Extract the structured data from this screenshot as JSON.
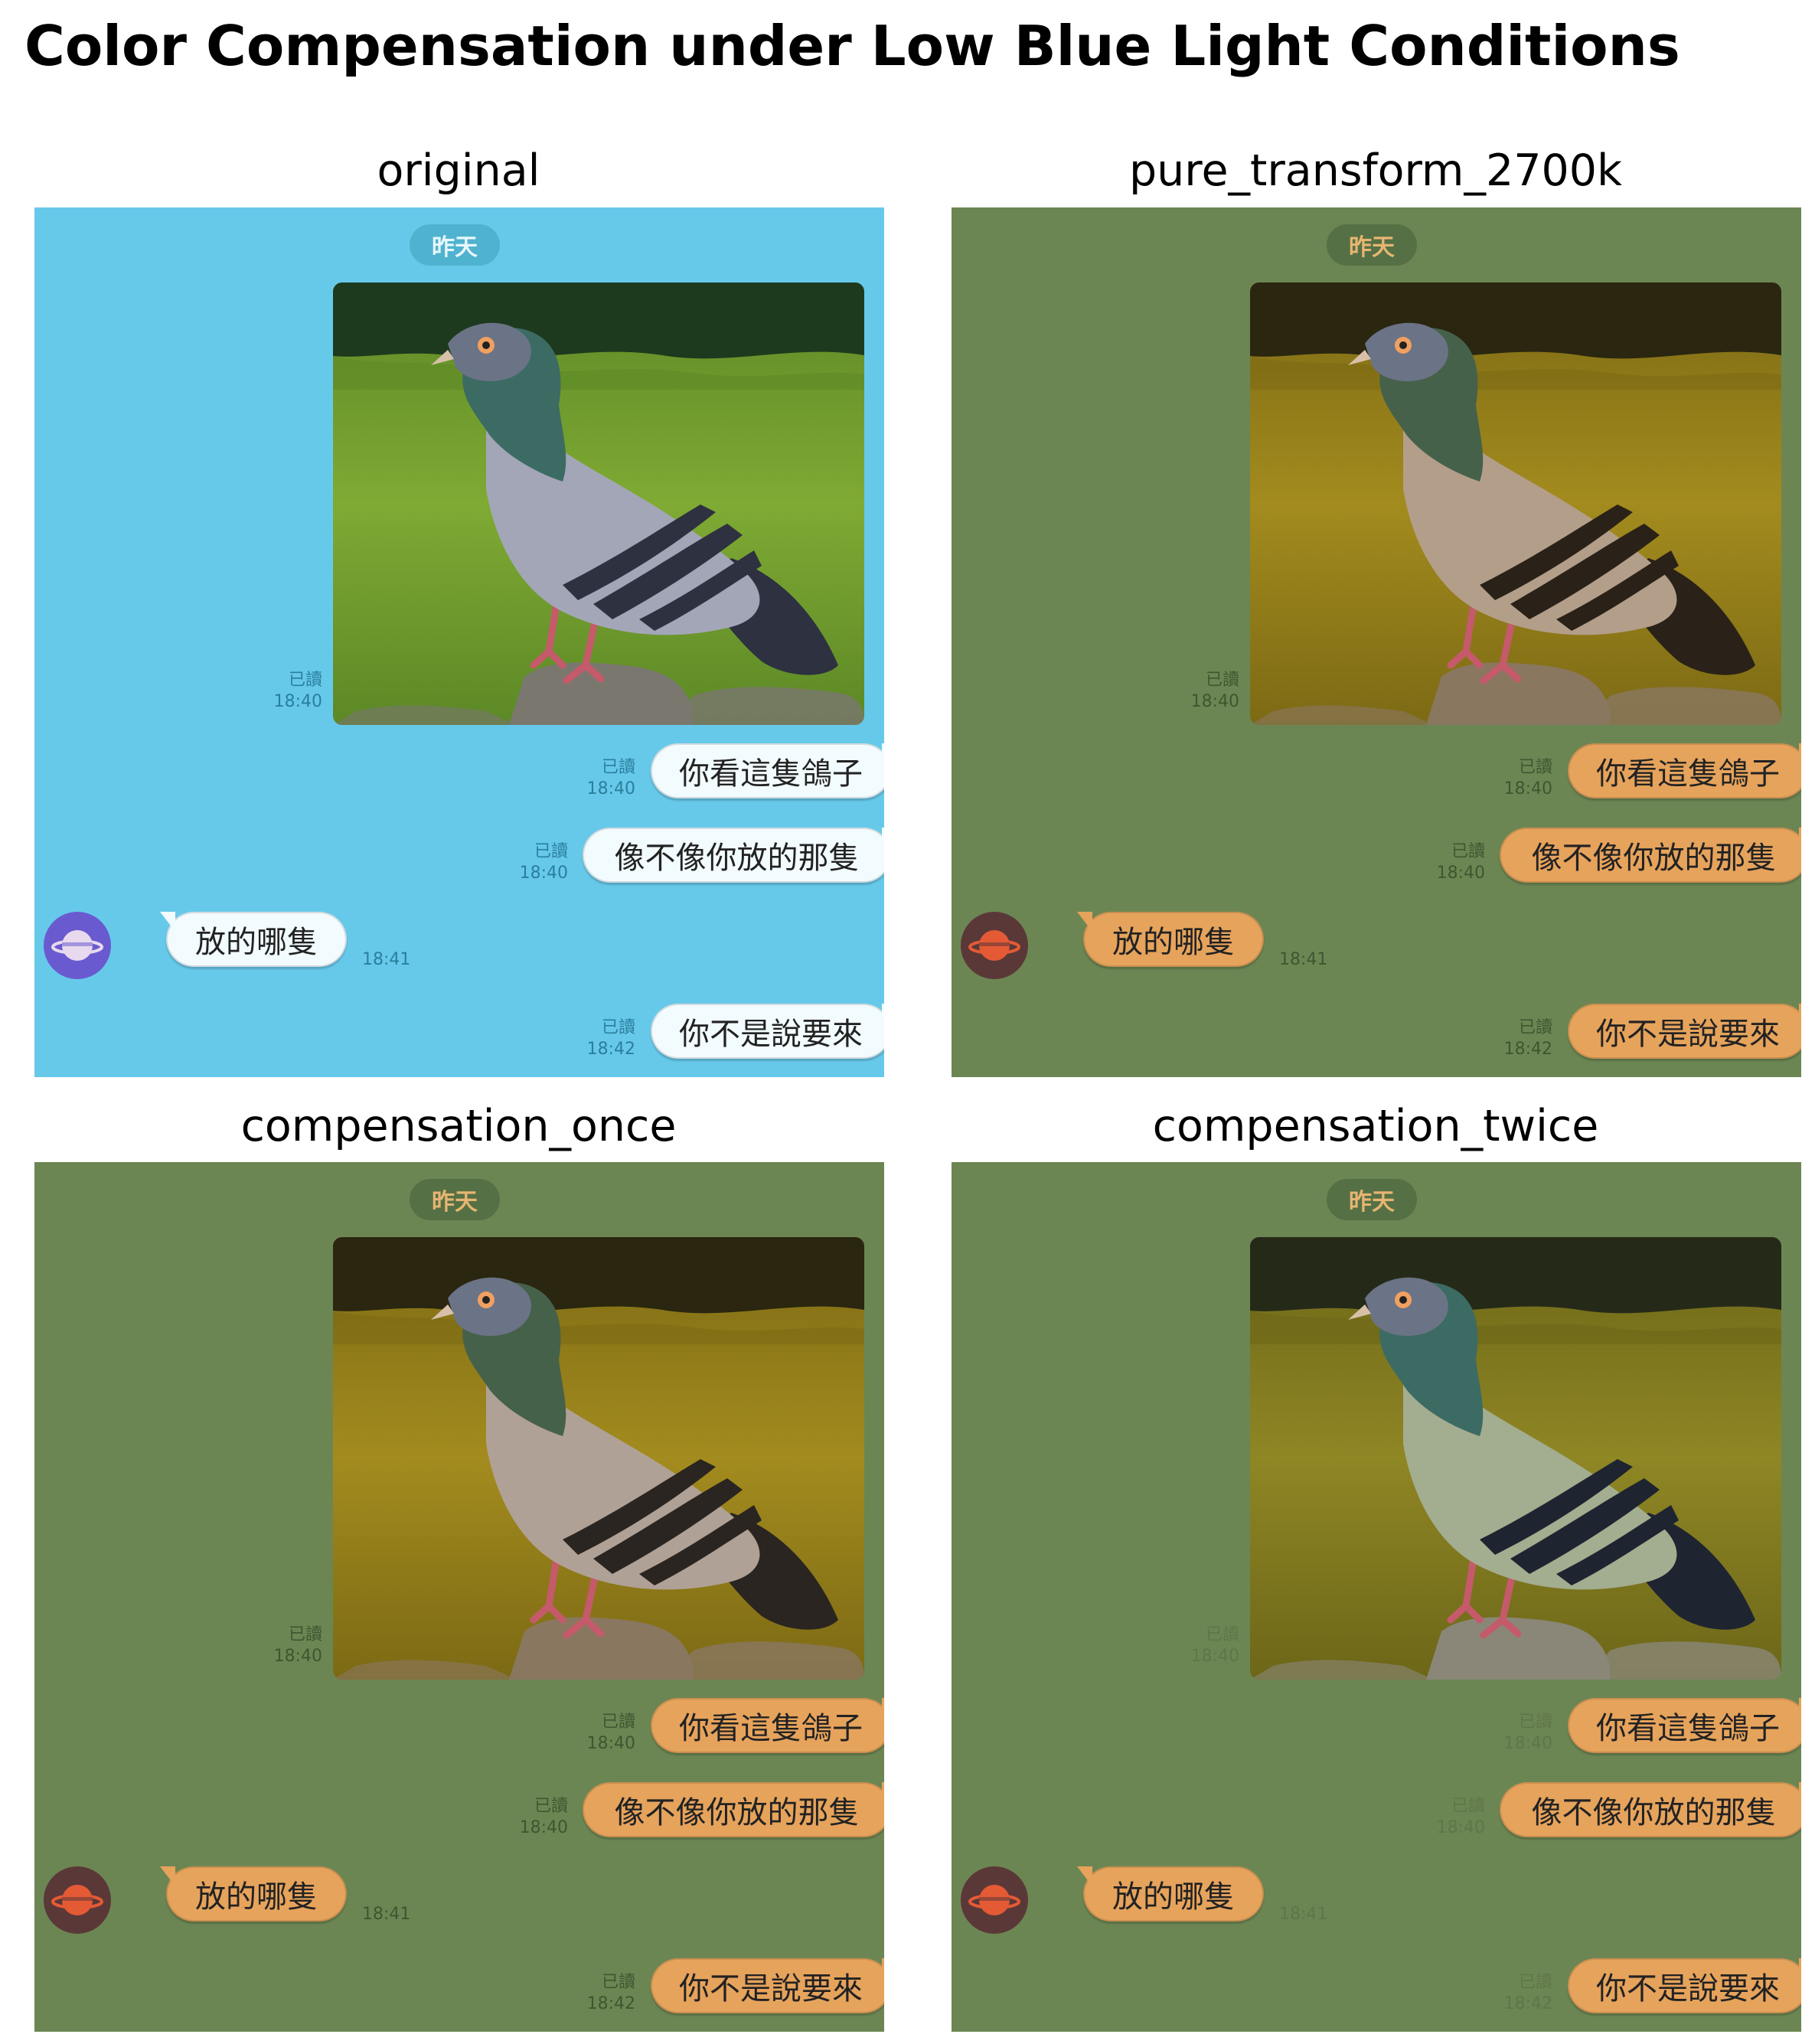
{
  "figure": {
    "title": "Color Compensation under Low Blue Light Conditions"
  },
  "chat": {
    "date_label": "昨天",
    "photo_read": "已讀",
    "photo_time": "18:40",
    "messages": [
      {
        "side": "right",
        "text": "你看這隻鴿子",
        "read": "已讀",
        "time": "18:40"
      },
      {
        "side": "right",
        "text": "像不像你放的那隻",
        "read": "已讀",
        "time": "18:40"
      },
      {
        "side": "left",
        "text": "放的哪隻",
        "time": "18:41"
      },
      {
        "side": "right",
        "text": "你不是說要來",
        "read": "已讀",
        "time": "18:42"
      }
    ],
    "photo_icon": "pigeon-photo",
    "avatar_icon": "planet-icon"
  },
  "panels": [
    {
      "title": "original",
      "colors": {
        "bg": "#67c9ea",
        "pill": "#4fb3cf",
        "pill_text": "#e8f7fc",
        "bubble": "#f2fbfe",
        "meta": "#2a7f9c",
        "grass": "#7faa34",
        "grass_dark": "#5c8826",
        "trees": "#1d3a1e",
        "bird_body": "#a3a6b7",
        "bird_dark": "#2d3140",
        "bird_neck": "#3c6b63",
        "rock": "#7a776f",
        "avatar_bg": "#6a5ad0",
        "avatar_planet": "#e8d9ee"
      }
    },
    {
      "title": "pure_transform_2700k",
      "colors": {
        "bg": "#6c8653",
        "pill": "#557044",
        "pill_text": "#e6b572",
        "bubble": "#e6a35c",
        "meta": "#3f5631",
        "grass": "#a38b1e",
        "grass_dark": "#7c6a14",
        "trees": "#2a2610",
        "bird_body": "#b39e8a",
        "bird_dark": "#2a2218",
        "bird_neck": "#46614a",
        "rock": "#8a7760",
        "avatar_bg": "#5a3838",
        "avatar_planet": "#e45a35"
      }
    },
    {
      "title": "compensation_once",
      "colors": {
        "bg": "#6c8653",
        "pill": "#557044",
        "pill_text": "#e6b572",
        "bubble": "#e6a35c",
        "meta": "#3f5631",
        "grass": "#a38b1e",
        "grass_dark": "#7c6a14",
        "trees": "#2a2610",
        "bird_body": "#b0a196",
        "bird_dark": "#2a2520",
        "bird_neck": "#46614a",
        "rock": "#8a7760",
        "avatar_bg": "#5a3838",
        "avatar_planet": "#e45a35"
      }
    },
    {
      "title": "compensation_twice",
      "colors": {
        "bg": "#6c8653",
        "pill": "#557044",
        "pill_text": "#e6b572",
        "bubble": "#e6a35c",
        "meta": "#5f7647",
        "grass": "#8f8624",
        "grass_dark": "#6c6618",
        "trees": "#252a18",
        "bird_body": "#a3ad8f",
        "bird_dark": "#1e2430",
        "bird_neck": "#3c6b63",
        "rock": "#8a8778",
        "avatar_bg": "#5a3838",
        "avatar_planet": "#e45a35"
      }
    }
  ]
}
